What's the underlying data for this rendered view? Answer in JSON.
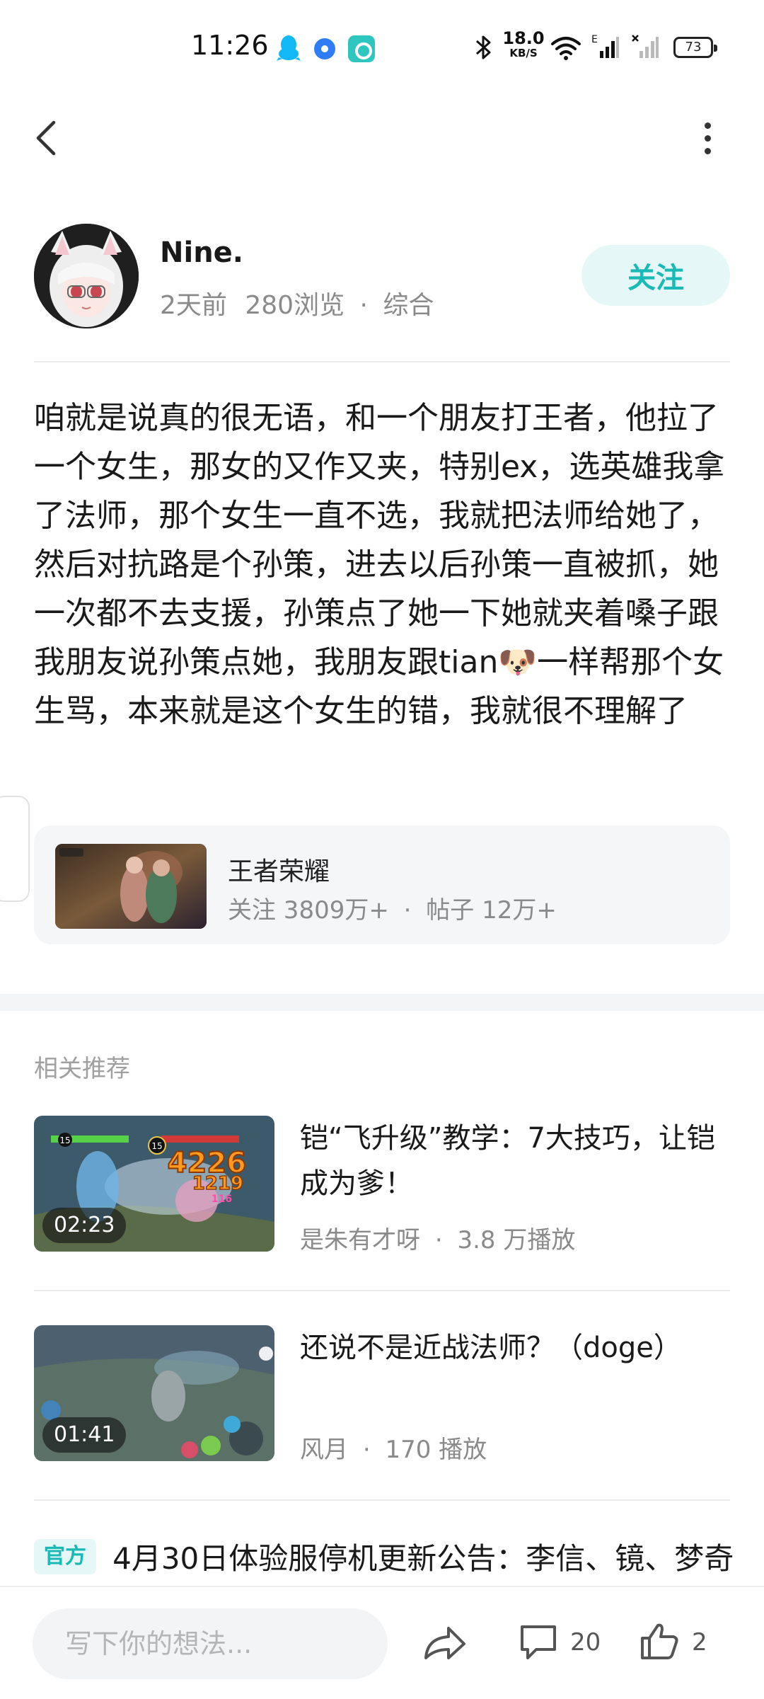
{
  "status_bar": {
    "time": "11:26",
    "net_speed_value": "18.0",
    "net_speed_unit": "KB/S",
    "signal_label": "E",
    "battery": "73",
    "icons": [
      "qq-icon",
      "app-circle-icon",
      "app-square-icon",
      "bluetooth-icon",
      "wifi-icon",
      "signal-icon",
      "no-signal-icon",
      "battery-icon"
    ]
  },
  "nav": {
    "back_icon": "chevron-left-icon",
    "more_icon": "more-vertical-icon"
  },
  "author": {
    "name": "Nine.",
    "time_ago": "2天前",
    "views": "280浏览",
    "category": "综合",
    "follow_label": "关注"
  },
  "post": {
    "text": "咱就是说真的很无语，和一个朋友打王者，他拉了一个女生，那女的又作又夹，特别ex，选英雄我拿了法师，那个女生一直不选，我就把法师给她了，然后对抗路是个孙策，进去以后孙策一直被抓，她一次都不去支援，孙策点了她一下她就夹着嗓子跟我朋友说孙策点她，我朋友跟tian🐶一样帮那个女生骂，本来就是这个女生的错，我就很不理解了"
  },
  "topic": {
    "name": "王者荣耀",
    "followers": "关注 3809万+",
    "posts": "帖子 12万+"
  },
  "recommend": {
    "title": "相关推荐",
    "videos": [
      {
        "title": "铠“飞升级”教学：7大技巧，让铠成为爹！",
        "author": "是朱有才呀",
        "plays": "3.8 万播放",
        "duration": "02:23",
        "overlay_numbers": [
          "15",
          "15",
          "4226",
          "1219",
          "116"
        ]
      },
      {
        "title": "还说不是近战法师？（doge）",
        "author": "风月",
        "plays": "170 播放",
        "duration": "01:41"
      }
    ]
  },
  "official": {
    "badge": "官方",
    "text": "4月30日体验服停机更新公告：李信、镜、梦奇"
  },
  "bottom_bar": {
    "input_placeholder": "写下你的想法...",
    "comment_count": "20",
    "like_count": "2"
  },
  "colors": {
    "accent": "#19b9b5",
    "accent_bg": "#e6f7f7",
    "muted_text": "#8a8a8a"
  }
}
